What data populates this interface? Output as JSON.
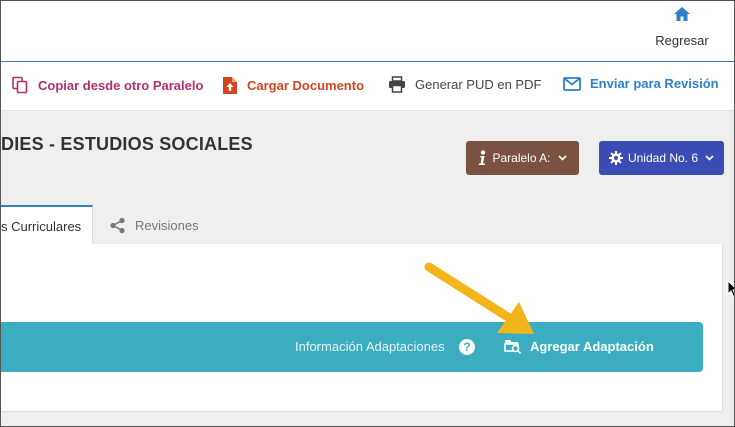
{
  "header": {
    "back_label": "Regresar",
    "back_icon": "home-icon"
  },
  "toolbar": {
    "copy_label": "Copiar desde otro Paralelo",
    "upload_label": "Cargar Documento",
    "pdf_label": "Generar PUD en PDF",
    "send_label": "Enviar para Revisión"
  },
  "page": {
    "title": "DIES - ESTUDIOS SOCIALES"
  },
  "selectors": {
    "paralelo_label": "Paralelo A:",
    "unidad_label": "Unidad No. 6"
  },
  "tabs": [
    {
      "label": "s Curriculares",
      "active": true
    },
    {
      "label": "Revisiones",
      "active": false
    }
  ],
  "adaptations": {
    "info_label": "Información Adaptaciones",
    "help_symbol": "?",
    "add_label": "Agregar Adaptación"
  },
  "colors": {
    "accent_blue": "#2f80c8",
    "copy_pink": "#b0306f",
    "upload_orange": "#d1461f",
    "paralelo_brown": "#7b5142",
    "unidad_blue": "#3a4db5",
    "bar_teal": "#3aaec0",
    "arrow_yellow": "#f3b51b"
  }
}
